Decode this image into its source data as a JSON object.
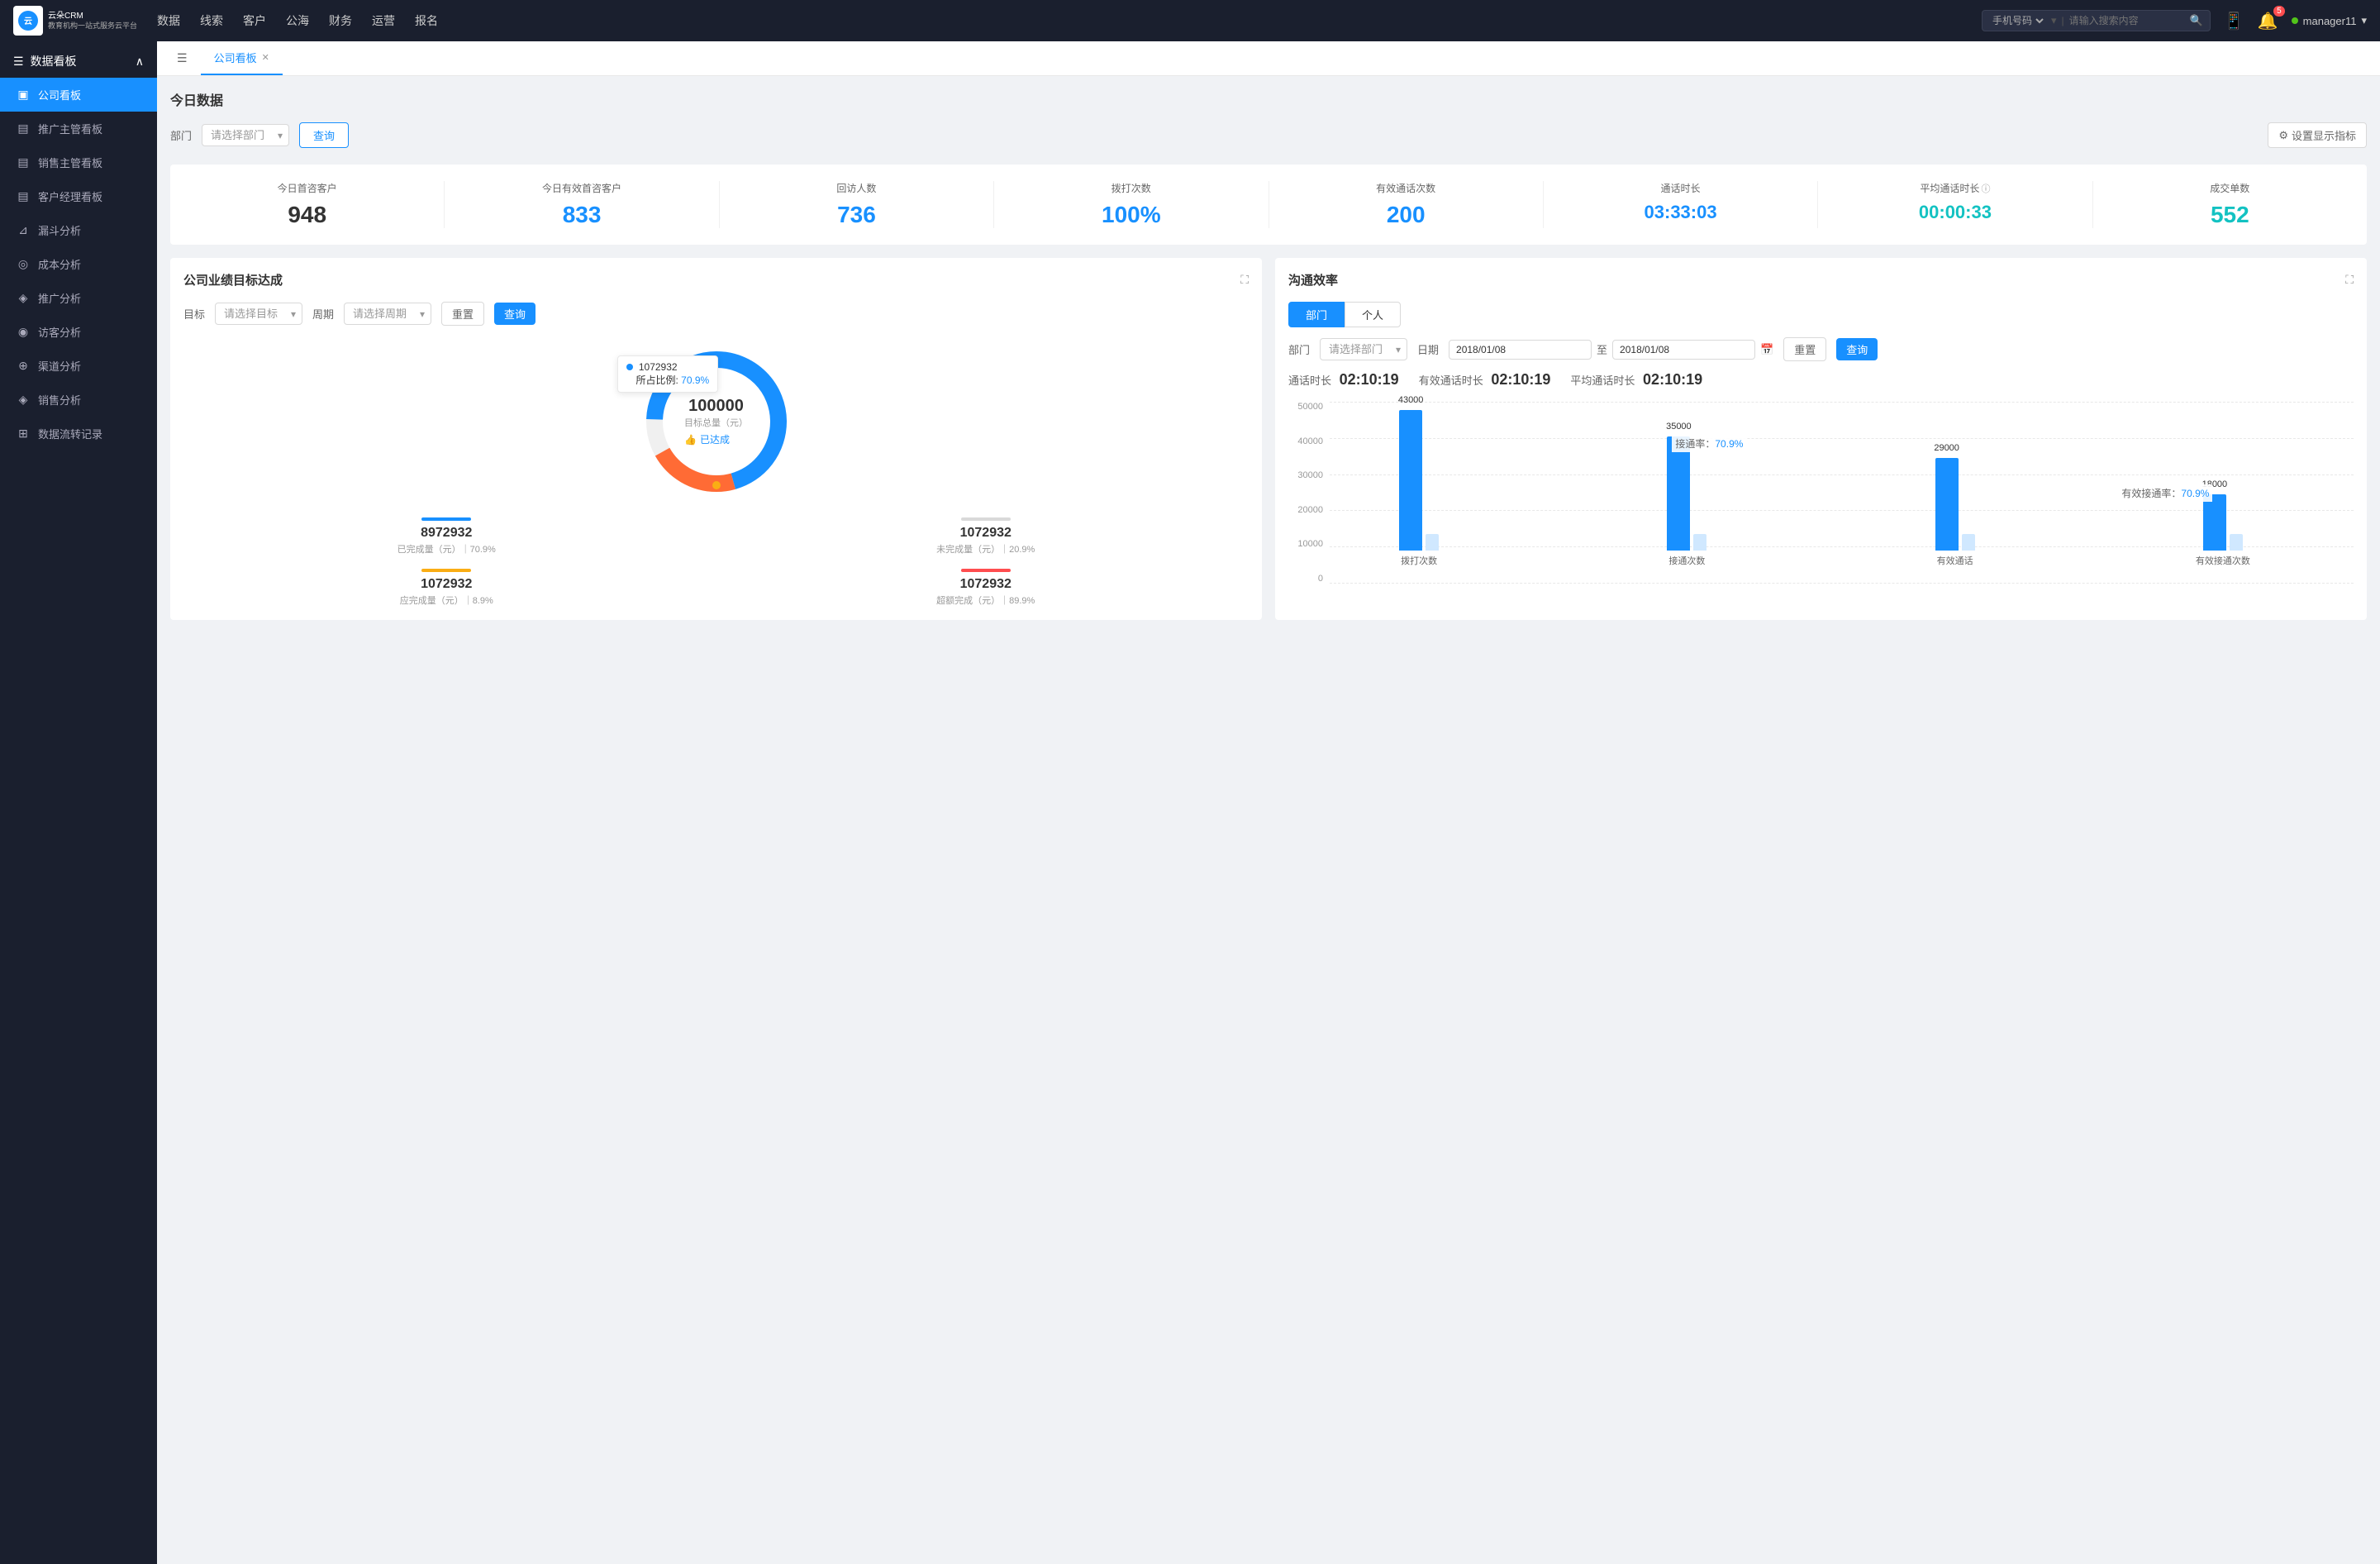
{
  "app": {
    "logo_text": "云朵CRM\n教育机构一站\n式服务云平台"
  },
  "top_nav": {
    "items": [
      "数据",
      "线索",
      "客户",
      "公海",
      "财务",
      "运营",
      "报名"
    ],
    "search_placeholder": "请输入搜索内容",
    "search_type": "手机号码",
    "notification_count": "5",
    "username": "manager11"
  },
  "sidebar": {
    "group_label": "数据看板",
    "items": [
      {
        "label": "公司看板",
        "active": true
      },
      {
        "label": "推广主管看板",
        "active": false
      },
      {
        "label": "销售主管看板",
        "active": false
      },
      {
        "label": "客户经理看板",
        "active": false
      },
      {
        "label": "漏斗分析",
        "active": false
      },
      {
        "label": "成本分析",
        "active": false
      },
      {
        "label": "推广分析",
        "active": false
      },
      {
        "label": "访客分析",
        "active": false
      },
      {
        "label": "渠道分析",
        "active": false
      },
      {
        "label": "销售分析",
        "active": false
      },
      {
        "label": "数据流转记录",
        "active": false
      }
    ]
  },
  "tabs": {
    "active_tab": "公司看板"
  },
  "today_section": {
    "title": "今日数据",
    "filter_label": "部门",
    "filter_placeholder": "请选择部门",
    "query_btn": "查询",
    "settings_btn": "设置显示指标"
  },
  "metrics": [
    {
      "label": "今日首咨客户",
      "value": "948",
      "color": "dark"
    },
    {
      "label": "今日有效首咨客户",
      "value": "833",
      "color": "blue"
    },
    {
      "label": "回访人数",
      "value": "736",
      "color": "blue"
    },
    {
      "label": "拨打次数",
      "value": "100%",
      "color": "blue"
    },
    {
      "label": "有效通话次数",
      "value": "200",
      "color": "blue"
    },
    {
      "label": "通话时长",
      "value": "03:33:03",
      "color": "blue"
    },
    {
      "label": "平均通话时长",
      "value": "00:00:33",
      "color": "cyan"
    },
    {
      "label": "成交单数",
      "value": "552",
      "color": "teal"
    }
  ],
  "company_panel": {
    "title": "公司业绩目标达成",
    "target_label": "目标",
    "target_placeholder": "请选择目标",
    "period_label": "周期",
    "period_placeholder": "请选择周期",
    "reset_btn": "重置",
    "query_btn": "查询",
    "donut": {
      "value": "100000",
      "sub": "目标总量（元）",
      "achieved_label": "已达成",
      "tooltip_id": "1072932",
      "tooltip_pct": "70.9%"
    },
    "grid_items": [
      {
        "bar_color": "#1890ff",
        "value": "8972932",
        "desc": "已完成量（元）｜70.9%"
      },
      {
        "bar_color": "#d9d9d9",
        "value": "1072932",
        "desc": "未完成量（元）｜20.9%"
      },
      {
        "bar_color": "#faad14",
        "value": "1072932",
        "desc": "应完成量（元）｜8.9%"
      },
      {
        "bar_color": "#ff4d4f",
        "value": "1072932",
        "desc": "超额完成（元）｜89.9%"
      }
    ]
  },
  "efficiency_panel": {
    "title": "沟通效率",
    "dept_btn": "部门",
    "personal_btn": "个人",
    "dept_label": "部门",
    "dept_placeholder": "请选择部门",
    "date_label": "日期",
    "date_from": "2018/01/08",
    "date_to": "2018/01/08",
    "reset_btn": "重置",
    "query_btn": "查询",
    "stats": [
      {
        "label": "通话时长",
        "value": "02:10:19"
      },
      {
        "label": "有效通话时长",
        "value": "02:10:19"
      },
      {
        "label": "平均通话时长",
        "value": "02:10:19"
      }
    ],
    "chart": {
      "y_labels": [
        "50000",
        "40000",
        "30000",
        "20000",
        "10000",
        "0"
      ],
      "groups": [
        {
          "x_label": "拨打次数",
          "bars": [
            {
              "height": 170,
              "color": "#1890ff",
              "label": "43000"
            },
            {
              "height": 20,
              "color": "#d0e8ff",
              "label": ""
            }
          ],
          "annotation": null
        },
        {
          "x_label": "接通次数",
          "bars": [
            {
              "height": 138,
              "color": "#1890ff",
              "label": "35000"
            },
            {
              "height": 20,
              "color": "#d0e8ff",
              "label": ""
            }
          ],
          "annotation": "接通率：70.9%"
        },
        {
          "x_label": "有效通话",
          "bars": [
            {
              "height": 112,
              "color": "#1890ff",
              "label": "29000"
            },
            {
              "height": 20,
              "color": "#d0e8ff",
              "label": ""
            }
          ],
          "annotation": null
        },
        {
          "x_label": "有效接通次数",
          "bars": [
            {
              "height": 68,
              "color": "#1890ff",
              "label": "18000"
            },
            {
              "height": 20,
              "color": "#d0e8ff",
              "label": ""
            }
          ],
          "annotation": "有效接通率：70.9%"
        }
      ]
    }
  }
}
